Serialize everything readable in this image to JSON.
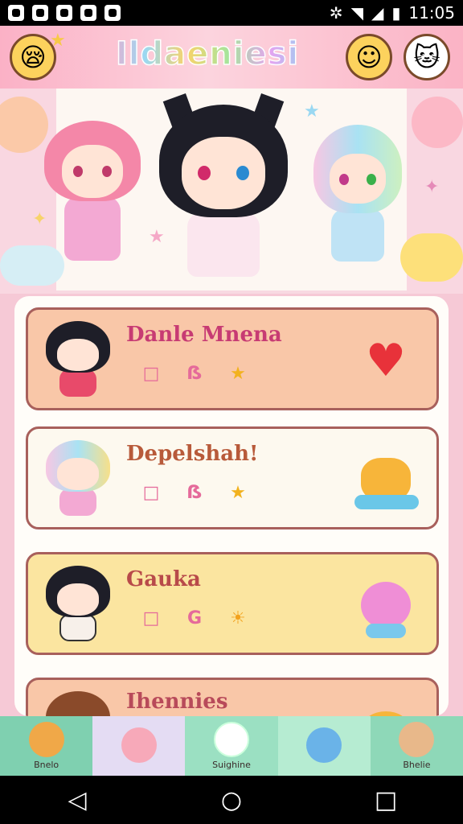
{
  "status_bar": {
    "time": "11:05",
    "left_icons": [
      "photo-icon",
      "gallery-icon",
      "chat-icon",
      "record-icon",
      "game-icon"
    ],
    "right_icons": [
      "vibrate-icon",
      "wifi-icon",
      "signal-icon",
      "battery-icon"
    ]
  },
  "header": {
    "title": "Ildaeniesi",
    "left_icon": "sleepy-face-icon",
    "right_icons": [
      "smile-face-icon",
      "cat-face-icon"
    ]
  },
  "cards": [
    {
      "name": "Danle Mnena",
      "meta": [
        "□",
        "ẞ",
        "★"
      ],
      "badge": "heart-icon",
      "bg": "#f9c7a8",
      "name_color": "#c73b73"
    },
    {
      "name": "Depelshah!",
      "meta": [
        "□",
        "ẞ",
        "★"
      ],
      "badge": "toy-icon",
      "bg": "#fdf9ef",
      "name_color": "#b85a3a"
    },
    {
      "name": "Gauka",
      "meta": [
        "□",
        "G",
        "☀"
      ],
      "badge": "plush-icon",
      "bg": "#fbe5a0",
      "name_color": "#b84a4a"
    },
    {
      "name": "Ihennies",
      "meta": [],
      "badge": "cookie-icon",
      "bg": "#f9c7a8",
      "name_color": "#b84a5a"
    }
  ],
  "tabs": [
    {
      "label": "Bnelo",
      "icon": "cat-tab-icon",
      "active": false
    },
    {
      "label": "",
      "icon": "girl-tab-icon",
      "active": true
    },
    {
      "label": "Suighine",
      "icon": "ghost-tab-icon",
      "active": false
    },
    {
      "label": "",
      "icon": "balloons-tab-icon",
      "active": false
    },
    {
      "label": "Bhelie",
      "icon": "boy-tab-icon",
      "active": false
    }
  ],
  "nav": [
    "back-icon",
    "home-icon",
    "recents-icon"
  ],
  "colors": {
    "header_bg": "#fbb1c6",
    "accent": "#c73b73",
    "tabbar_bg": "#8ed8b8"
  }
}
